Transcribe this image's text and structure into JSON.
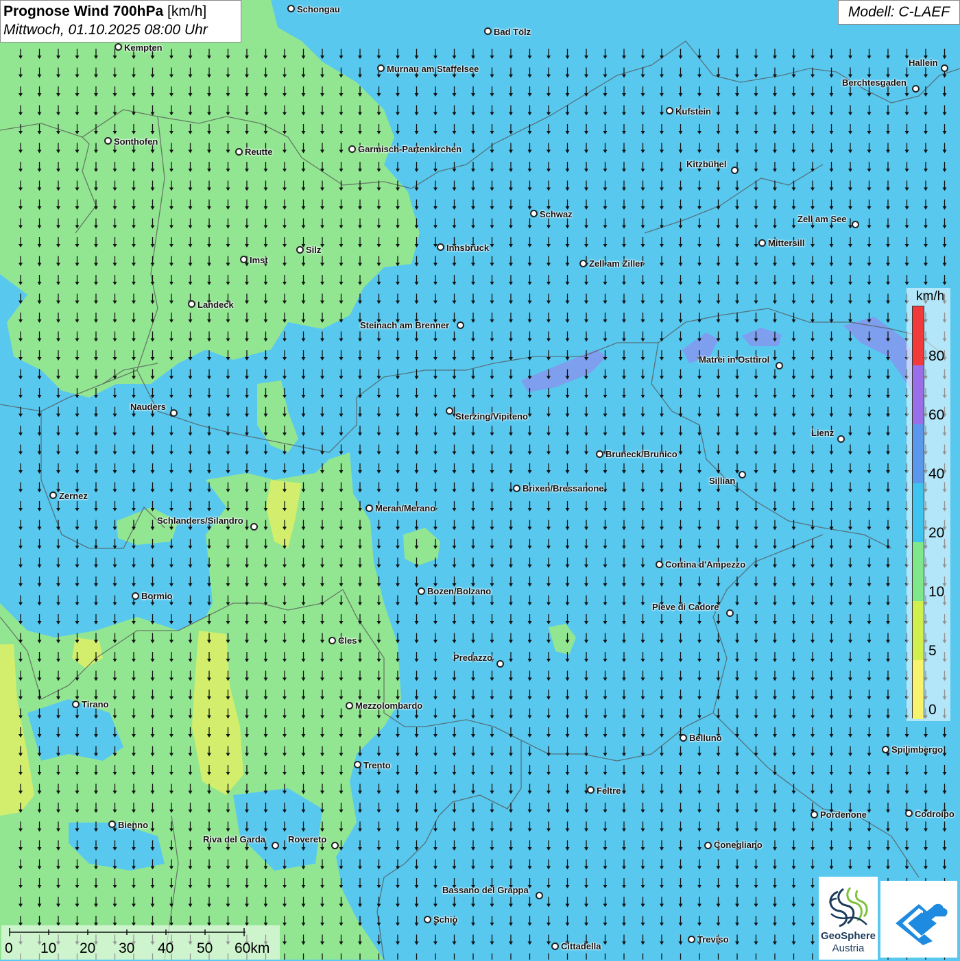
{
  "header": {
    "title_bold": "Prognose Wind 700hPa",
    "title_unit": "[km/h]",
    "datetime": "Mittwoch, 01.10.2025 08:00 Uhr",
    "model": "Modell: C-LAEF"
  },
  "legend": {
    "unit": "km/h",
    "labels": [
      "80",
      "60",
      "40",
      "20",
      "10",
      "5",
      "0"
    ],
    "colors": [
      "#f23a3a",
      "#9a6ee8",
      "#5a98ee",
      "#3fc4ef",
      "#7fe88a",
      "#d0f04e",
      "#f7f36c"
    ]
  },
  "scalebar": {
    "labels": [
      "0",
      "10",
      "20",
      "30",
      "40",
      "50",
      "60km"
    ]
  },
  "logo": {
    "name_line1": "GeoSphere",
    "name_line2": "Austria",
    "colors": {
      "navy": "#1b3a5c",
      "green": "#7ec23f",
      "blue": "#1f8be0"
    }
  },
  "map_colors": {
    "wind_20_40": "#58c8ef",
    "wind_10_20": "#92e692",
    "wind_5_10": "#d2ee6c",
    "wind_0_5": "#ecef74",
    "wind_40_60": "#7e9eee"
  },
  "wind_direction": "north wind (arrows pointing south)",
  "cities": [
    "Schongau",
    "Bad Tölz",
    "Kempten",
    "Murnau am Staffelsee",
    "Hallein",
    "Berchtesgaden",
    "Kufstein",
    "Sonthofen",
    "Reutte",
    "Garmisch-Partenkirchen",
    "Kitzbühel",
    "Schwaz",
    "Zell am See",
    "Mittersill",
    "Innsbruck",
    "Zell am Ziller",
    "Silz",
    "Imst",
    "Landeck",
    "Steinach am Brenner",
    "Matrei in Osttirol",
    "Nauders",
    "Sterzing/Vipiteno",
    "Lienz",
    "Bruneck/Brunico",
    "Sillian",
    "Zernez",
    "Brixen/Bressanone",
    "Meran/Merano",
    "Schlanders/Silandro",
    "Cortina d'Ampezzo",
    "Bozen/Bolzano",
    "Bormio",
    "Pieve di Cadore",
    "Cles",
    "Predazzo",
    "Tirano",
    "Mezzolombardo",
    "Belluno",
    "Spilimbergo",
    "Trento",
    "Feltre",
    "Pordenone",
    "Codroipo",
    "Bienno",
    "Riva del Garda",
    "Rovereto",
    "Conegliano",
    "Bassano del Grappa",
    "Schio",
    "Treviso",
    "Cittadella"
  ]
}
